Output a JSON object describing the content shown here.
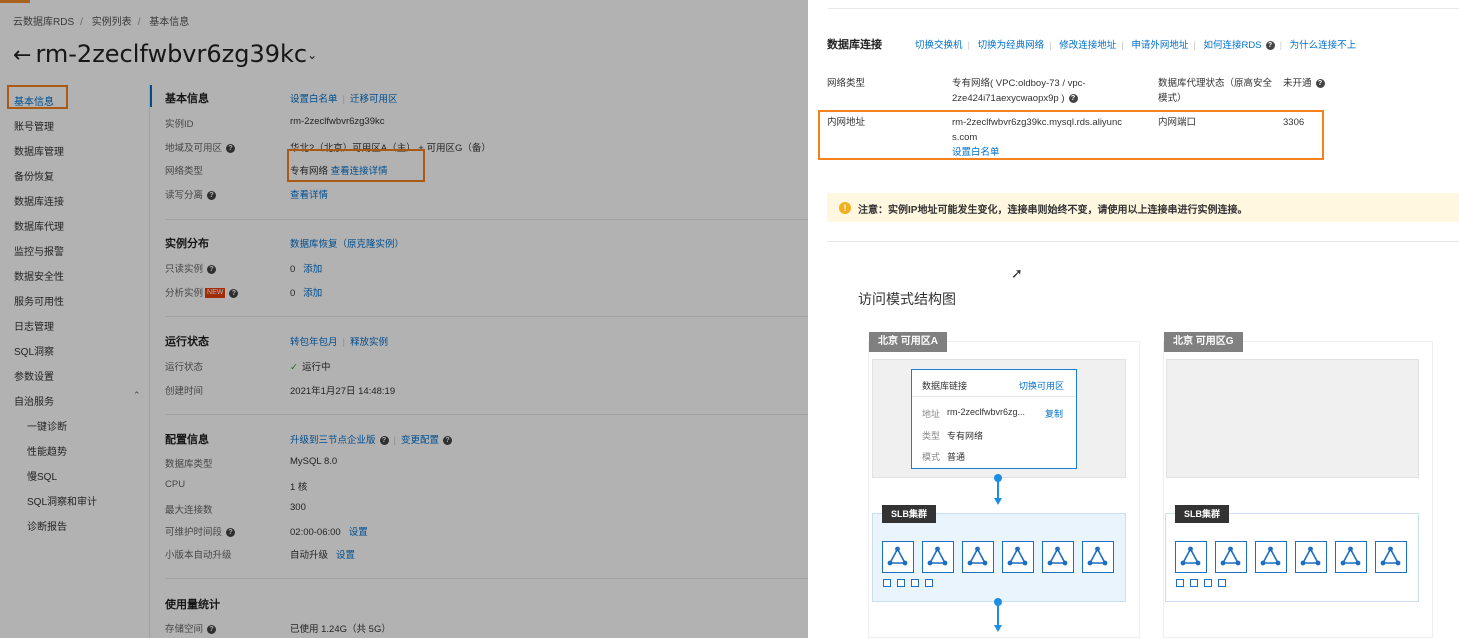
{
  "breadcrumb": [
    "云数据库RDS",
    "实例列表",
    "基本信息"
  ],
  "instance_title": "rm-2zeclfwbvr6zg39kc",
  "nav": {
    "items": [
      "基本信息",
      "账号管理",
      "数据库管理",
      "备份恢复",
      "数据库连接",
      "数据库代理",
      "监控与报警",
      "数据安全性",
      "服务可用性",
      "日志管理",
      "SQL洞察",
      "参数设置",
      "自治服务"
    ],
    "sub_items": [
      "一键诊断",
      "性能趋势",
      "慢SQL",
      "SQL洞察和审计",
      "诊断报告"
    ]
  },
  "basic": {
    "title": "基本信息",
    "links": [
      "设置白名单",
      "迁移可用区"
    ],
    "rows": [
      {
        "label": "实例ID",
        "value": "rm-2zeclfwbvr6zg39kc"
      },
      {
        "label": "地域及可用区",
        "value": "华北2（北京）可用区A（主） + 可用区G（备）"
      },
      {
        "label": "网络类型",
        "value": "专有网络",
        "link": "查看连接详情"
      },
      {
        "label": "读写分离",
        "value": "",
        "link": "查看详情"
      }
    ]
  },
  "distribution": {
    "title": "实例分布",
    "link": "数据库恢复（原克隆实例）",
    "rows": [
      {
        "label": "只读实例",
        "value": "0",
        "link": "添加"
      },
      {
        "label": "分析实例",
        "tag": "NEW",
        "value": "0",
        "link": "添加"
      }
    ]
  },
  "running": {
    "title": "运行状态",
    "links": [
      "转包年包月",
      "释放实例"
    ],
    "rows": [
      {
        "label": "运行状态",
        "value": "运行中"
      },
      {
        "label": "创建时间",
        "value": "2021年1月27日 14:48:19"
      }
    ]
  },
  "config": {
    "title": "配置信息",
    "links": [
      "升级到三节点企业版",
      "变更配置"
    ],
    "rows": [
      {
        "label": "数据库类型",
        "value": "MySQL  8.0"
      },
      {
        "label": "CPU",
        "value": "1 核"
      },
      {
        "label": "最大连接数",
        "value": "300"
      },
      {
        "label": "可维护时间段",
        "value": "02:00-06:00",
        "link": "设置"
      },
      {
        "label": "小版本自动升级",
        "value": "自动升级",
        "link": "设置"
      }
    ]
  },
  "usage": {
    "title": "使用量统计",
    "rows": [
      {
        "label": "存储空间",
        "value": "已使用 1.24G（共 5G）"
      }
    ]
  },
  "drawer": {
    "title": "数据库连接",
    "actions": [
      "切换交换机",
      "切换为经典网络",
      "修改连接地址",
      "申请外网地址",
      "如何连接RDS",
      "为什么连接不上"
    ],
    "network_type_label": "网络类型",
    "network_type_value_1": "专有网络( VPC:oldboy-73 / vpc-",
    "network_type_value_2": "2ze424i71aexycwaopx9p )",
    "proxy_label_1": "数据库代理状态（原高安全",
    "proxy_label_2": "模式）",
    "proxy_value": "未开通",
    "internal_addr_label": "内网地址",
    "internal_addr_1": "rm-2zeclfwbvr6zg39kc.mysql.rds.aliyunc",
    "internal_addr_2": "s.com",
    "whitelist_link": "设置白名单",
    "internal_port_label": "内网端口",
    "internal_port_value": "3306",
    "notice": "注意：实例IP地址可能发生变化，连接串则始终不变，请使用以上连接串进行实例连接。",
    "diagram_title": "访问模式结构图",
    "zone_a": "北京 可用区A",
    "zone_g": "北京 可用区G",
    "card": {
      "title": "数据库链接",
      "switch_link": "切换可用区",
      "addr_label": "地址",
      "addr_value": "rm-2zeclfwbvr6zg...",
      "copy_link": "复制",
      "type_label": "类型",
      "type_value": "专有网络",
      "mode_label": "模式",
      "mode_value": "普通"
    },
    "slb_label": "SLB集群"
  },
  "colors": {
    "accent": "#0070cc",
    "highlight": "#f5811f",
    "node": "#1c6fc2"
  }
}
